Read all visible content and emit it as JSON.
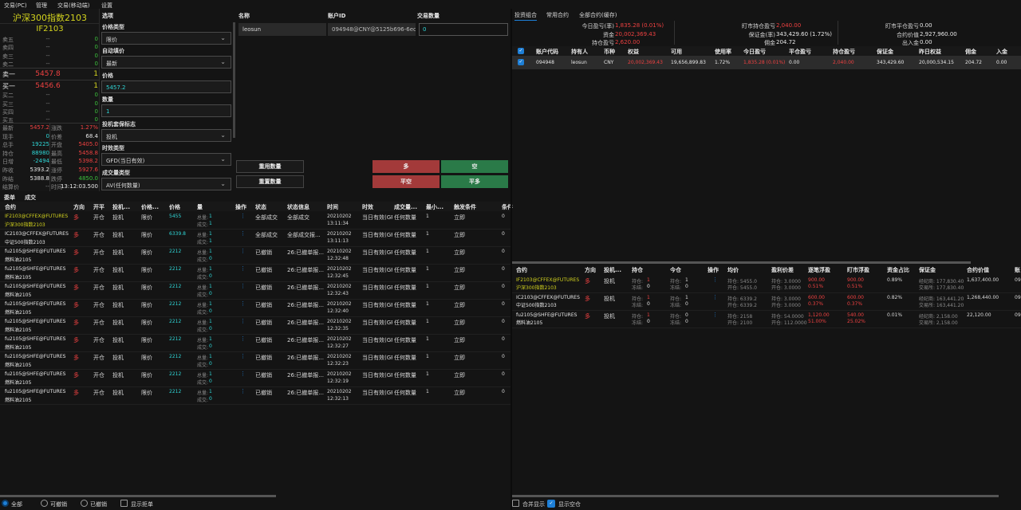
{
  "menu": {
    "items": [
      "交易(PC)",
      "管理",
      "交易(移动端)"
    ],
    "settings": "设置"
  },
  "quote": {
    "name": "沪深300指数2103",
    "code": "IF2103",
    "book": [
      {
        "label": "卖五",
        "price": "--",
        "vol": "0"
      },
      {
        "label": "卖四",
        "price": "--",
        "vol": "0"
      },
      {
        "label": "卖三",
        "price": "--",
        "vol": "0"
      },
      {
        "label": "卖二",
        "price": "--",
        "vol": "0"
      },
      {
        "label": "卖一",
        "price": "5457.8",
        "vol": "1"
      },
      {
        "label": "买一",
        "price": "5456.6",
        "vol": "1"
      },
      {
        "label": "买二",
        "price": "--",
        "vol": "0"
      },
      {
        "label": "买三",
        "price": "--",
        "vol": "0"
      },
      {
        "label": "买四",
        "price": "--",
        "vol": "0"
      },
      {
        "label": "买五",
        "price": "--",
        "vol": "0"
      }
    ],
    "stats": [
      [
        "最新",
        "5457.2",
        "涨跌",
        "1.27%"
      ],
      [
        "现手",
        "0",
        "价差",
        "68.4"
      ],
      [
        "总手",
        "19225",
        "开盘",
        "5405.0"
      ],
      [
        "持仓",
        "88980",
        "最高",
        "5458.8"
      ],
      [
        "日增",
        "-2494",
        "最低",
        "5398.2"
      ],
      [
        "昨收",
        "5393.2",
        "涨停",
        "5927.6"
      ],
      [
        "昨结",
        "5388.8",
        "跌停",
        "4850.0"
      ],
      [
        "结算价",
        "--",
        "时间",
        "13:12:03.500"
      ]
    ]
  },
  "form": {
    "header": "选项",
    "fields": [
      {
        "label": "价格类型",
        "value": "限价"
      },
      {
        "label": "自动填价",
        "value": "最新"
      },
      {
        "label": "价格",
        "value": "5457.2"
      },
      {
        "label": "数量",
        "value": "1"
      },
      {
        "label": "投机套保标志",
        "value": "投机"
      },
      {
        "label": "时效类型",
        "value": "GFD(当日有效)"
      },
      {
        "label": "成交量类型",
        "value": "AV(任何数量)"
      }
    ]
  },
  "accounts": {
    "headers": [
      "名称",
      "账户ID",
      "交易数量"
    ],
    "row": {
      "name": "leosun",
      "id": "094948@CNY@5125b696-6ec...",
      "qty": "0"
    }
  },
  "buttons": {
    "reuse": "重用数量",
    "reset": "重置数量",
    "long": "多",
    "short": "空",
    "close_short": "平空",
    "close_long": "平多"
  },
  "colors": {
    "red": "#a33a3a",
    "green": "#2a7a48",
    "accent": "#1e7fd6"
  },
  "right_tabs": [
    "投资组合",
    "常用合约",
    "全部合约(缓存)"
  ],
  "summary": [
    [
      "今日盈亏(率)",
      "1,835.28 (0.01%)",
      "red"
    ],
    [
      "资金",
      "20,002,369.43",
      "red"
    ],
    [
      "持仓盈亏",
      "2,620.00",
      "red"
    ],
    [
      "盯市持仓盈亏",
      "2,040.00",
      "red"
    ],
    [
      "保证金(率)",
      "343,429.60 (1.72%)",
      ""
    ],
    [
      "佣金",
      "204.72",
      ""
    ],
    [
      "盯市平仓盈亏",
      "0.00",
      ""
    ],
    [
      "合约价值",
      "2,927,960.00",
      ""
    ],
    [
      "出入金",
      "0.00",
      ""
    ]
  ],
  "acct_table": {
    "headers": [
      "账户代码",
      "持有人",
      "币种",
      "权益",
      "可用",
      "使用率",
      "今日盈亏",
      "平仓盈亏",
      "持仓盈亏",
      "保证金",
      "昨日权益",
      "佣金",
      "入金"
    ],
    "row": [
      "094948",
      "leosun",
      "CNY",
      "20,002,369.43",
      "19,656,899.83",
      "1.72%",
      "1,835.28 (0.01%)",
      "0.00",
      "2,040.00",
      "343,429.60",
      "20,000,534.15",
      "204.72",
      "0.00"
    ]
  },
  "order_tabs": [
    "委单",
    "成交"
  ],
  "orders": {
    "headers": [
      "合约",
      "方向",
      "开平",
      "投机...",
      "价格...",
      "价格",
      "量",
      "操作",
      "状态",
      "状态信息",
      "时间",
      "时效",
      "成交量...",
      "最小...",
      "触发条件",
      "条件"
    ],
    "rows": [
      {
        "c1": "IF2103@CFFEX@FUTURES",
        "c2": "沪深300指数2103",
        "dir": "多",
        "oc": "开仓",
        "spec": "投机",
        "pt": "限价",
        "price": "5455",
        "total": "1",
        "filled": "1",
        "status": "全部成交",
        "info": "全部成交",
        "date": "20210202",
        "time": "13:11:34",
        "tif": "当日有效(GF",
        "vt": "任何数量",
        "min": "1",
        "trig": "立即",
        "cond": "0"
      },
      {
        "c1": "IC2103@CFFEX@FUTURES",
        "c2": "中证500指数2103",
        "dir": "多",
        "oc": "开仓",
        "spec": "投机",
        "pt": "限价",
        "price": "6339.8",
        "total": "1",
        "filled": "1",
        "status": "全部成交",
        "info": "全部成交报...",
        "date": "20210202",
        "time": "13:11:13",
        "tif": "当日有效(GF",
        "vt": "任何数量",
        "min": "1",
        "trig": "立即",
        "cond": "0"
      },
      {
        "c1": "fu2105@SHFE@FUTURES",
        "c2": "燃料油2105",
        "dir": "多",
        "oc": "开仓",
        "spec": "投机",
        "pt": "限价",
        "price": "2212",
        "total": "1",
        "filled": "0",
        "status": "已撤销",
        "info": "26:已撤单报...",
        "date": "20210202",
        "time": "12:32:48",
        "tif": "当日有效(GF",
        "vt": "任何数量",
        "min": "1",
        "trig": "立即",
        "cond": "0"
      },
      {
        "c1": "fu2105@SHFE@FUTURES",
        "c2": "燃料油2105",
        "dir": "多",
        "oc": "开仓",
        "spec": "投机",
        "pt": "限价",
        "price": "2212",
        "total": "1",
        "filled": "0",
        "status": "已撤销",
        "info": "26:已撤单报...",
        "date": "20210202",
        "time": "12:32:45",
        "tif": "当日有效(GF",
        "vt": "任何数量",
        "min": "1",
        "trig": "立即",
        "cond": "0"
      },
      {
        "c1": "fu2105@SHFE@FUTURES",
        "c2": "燃料油2105",
        "dir": "多",
        "oc": "开仓",
        "spec": "投机",
        "pt": "限价",
        "price": "2212",
        "total": "1",
        "filled": "0",
        "status": "已撤销",
        "info": "26:已撤单报...",
        "date": "20210202",
        "time": "12:32:43",
        "tif": "当日有效(GF",
        "vt": "任何数量",
        "min": "1",
        "trig": "立即",
        "cond": "0"
      },
      {
        "c1": "fu2105@SHFE@FUTURES",
        "c2": "燃料油2105",
        "dir": "多",
        "oc": "开仓",
        "spec": "投机",
        "pt": "限价",
        "price": "2212",
        "total": "1",
        "filled": "0",
        "status": "已撤销",
        "info": "26:已撤单报...",
        "date": "20210202",
        "time": "12:32:40",
        "tif": "当日有效(GF",
        "vt": "任何数量",
        "min": "1",
        "trig": "立即",
        "cond": "0"
      },
      {
        "c1": "fu2105@SHFE@FUTURES",
        "c2": "燃料油2105",
        "dir": "多",
        "oc": "开仓",
        "spec": "投机",
        "pt": "限价",
        "price": "2212",
        "total": "1",
        "filled": "0",
        "status": "已撤销",
        "info": "26:已撤单报...",
        "date": "20210202",
        "time": "12:32:35",
        "tif": "当日有效(GF",
        "vt": "任何数量",
        "min": "1",
        "trig": "立即",
        "cond": "0"
      },
      {
        "c1": "fu2105@SHFE@FUTURES",
        "c2": "燃料油2105",
        "dir": "多",
        "oc": "开仓",
        "spec": "投机",
        "pt": "限价",
        "price": "2212",
        "total": "1",
        "filled": "0",
        "status": "已撤销",
        "info": "26:已撤单报...",
        "date": "20210202",
        "time": "12:32:27",
        "tif": "当日有效(GF",
        "vt": "任何数量",
        "min": "1",
        "trig": "立即",
        "cond": "0"
      },
      {
        "c1": "fu2105@SHFE@FUTURES",
        "c2": "燃料油2105",
        "dir": "多",
        "oc": "开仓",
        "spec": "投机",
        "pt": "限价",
        "price": "2212",
        "total": "1",
        "filled": "0",
        "status": "已撤销",
        "info": "26:已撤单报...",
        "date": "20210202",
        "time": "12:32:23",
        "tif": "当日有效(GF",
        "vt": "任何数量",
        "min": "1",
        "trig": "立即",
        "cond": "0"
      },
      {
        "c1": "fu2105@SHFE@FUTURES",
        "c2": "燃料油2105",
        "dir": "多",
        "oc": "开仓",
        "spec": "投机",
        "pt": "限价",
        "price": "2212",
        "total": "1",
        "filled": "0",
        "status": "已撤销",
        "info": "26:已撤单报...",
        "date": "20210202",
        "time": "12:32:19",
        "tif": "当日有效(GF",
        "vt": "任何数量",
        "min": "1",
        "trig": "立即",
        "cond": "0"
      },
      {
        "c1": "fu2105@SHFE@FUTURES",
        "c2": "燃料油2105",
        "dir": "多",
        "oc": "开仓",
        "spec": "投机",
        "pt": "限价",
        "price": "2212",
        "total": "1",
        "filled": "0",
        "status": "已撤销",
        "info": "26:已撤单报...",
        "date": "20210202",
        "time": "12:32:13",
        "tif": "当日有效(GF",
        "vt": "任何数量",
        "min": "1",
        "trig": "立即",
        "cond": "0"
      }
    ],
    "total_label": "总量:",
    "filled_label": "成交:"
  },
  "positions": {
    "headers": [
      "合约",
      "方向",
      "投机...",
      "持仓",
      "今仓",
      "操作",
      "均价",
      "盈利价差",
      "逐笔浮盈",
      "盯市浮盈",
      "资金占比",
      "保证金",
      "合约价值",
      "账"
    ],
    "rows": [
      {
        "c1": "IF2103@CFFEX@FUTURES",
        "c2": "沪深300指数2103",
        "dir": "多",
        "spec": "投机",
        "pos": "1",
        "frz": "0",
        "tpos": "1",
        "tfrz": "0",
        "avg1": "持仓: 5455.0",
        "avg2": "开仓: 5455.0",
        "sp1": "持仓: 3.0000",
        "sp2": "开仓: 3.0000",
        "fp1": "900.00",
        "fp2": "0.51%",
        "mp1": "900.00",
        "mp2": "0.51%",
        "ratio": "0.89%",
        "m1": "经纪商: 177,830.40",
        "m2": "交易所: 177,830.40",
        "val": "1,637,400.00",
        "acct": "09"
      },
      {
        "c1": "IC2103@CFFEX@FUTURES",
        "c2": "中证500指数2103",
        "dir": "多",
        "spec": "投机",
        "pos": "1",
        "frz": "0",
        "tpos": "1",
        "tfrz": "0",
        "avg1": "持仓: 6339.2",
        "avg2": "开仓: 6339.2",
        "sp1": "持仓: 3.0000",
        "sp2": "开仓: 3.0000",
        "fp1": "600.00",
        "fp2": "0.37%",
        "mp1": "600.00",
        "mp2": "0.37%",
        "ratio": "0.82%",
        "m1": "经纪商: 163,441.20",
        "m2": "交易所: 163,441.20",
        "val": "1,268,440.00",
        "acct": "09"
      },
      {
        "c1": "fu2105@SHFE@FUTURES",
        "c2": "燃料油2105",
        "dir": "多",
        "spec": "投机",
        "pos": "1",
        "frz": "0",
        "tpos": "0",
        "tfrz": "0",
        "avg1": "持仓: 2158",
        "avg2": "开仓: 2100",
        "sp1": "持仓: 54.0000",
        "sp2": "开仓: 112.0000",
        "fp1": "1,120.00",
        "fp2": "51.00%",
        "mp1": "540.00",
        "mp2": "25.02%",
        "ratio": "0.01%",
        "m1": "经纪商: 2,158.00",
        "m2": "交易所: 2,158.00",
        "val": "22,120.00",
        "acct": "09"
      }
    ],
    "pos_label": "持仓:",
    "frz_label": "冻结:"
  },
  "filters": {
    "all": "全部",
    "cancelable": "可撤销",
    "canceled": "已撤销",
    "show_rejected": "显示拒单",
    "merge": "合并显示",
    "show_empty": "显示空仓"
  }
}
